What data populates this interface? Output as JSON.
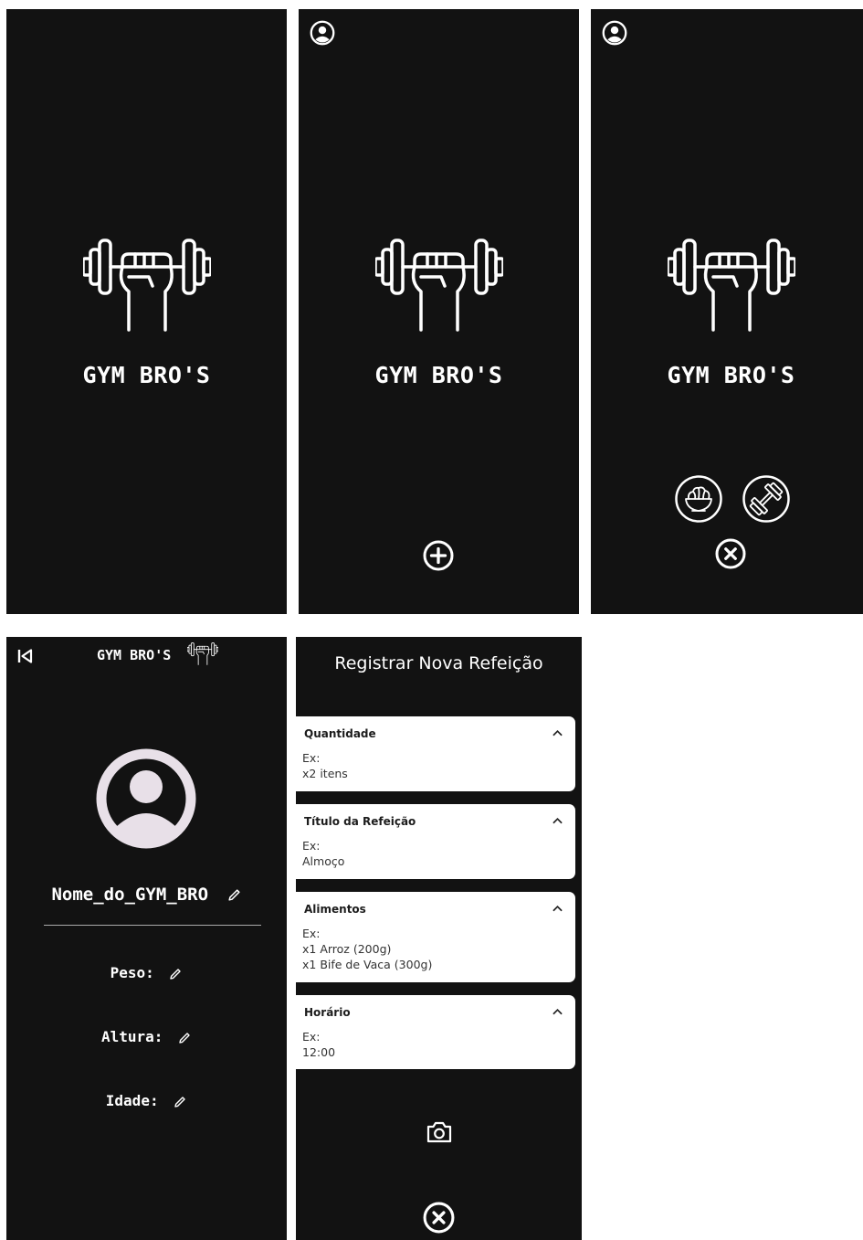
{
  "brand": "GYM BRO'S",
  "profile": {
    "title": "GYM BRO'S",
    "username": "Nome_do_GYM_BRO",
    "fields": [
      "Peso:",
      "Altura:",
      "Idade:"
    ]
  },
  "meal": {
    "title": "Registrar Nova Refeição",
    "cards": [
      {
        "label": "Quantidade",
        "lines": [
          "Ex:",
          "x2 itens"
        ]
      },
      {
        "label": "Título da Refeição",
        "lines": [
          "Ex:",
          "Almoço"
        ]
      },
      {
        "label": "Alimentos",
        "lines": [
          "Ex:",
          "x1 Arroz (200g)",
          "x1 Bife de Vaca (300g)"
        ]
      },
      {
        "label": "Horário",
        "lines": [
          "Ex:",
          "12:00"
        ]
      }
    ]
  },
  "icons": {
    "logo": "dumbbell-hand-icon",
    "profile": "user-circle-icon",
    "add": "plus-circle-icon",
    "close": "x-circle-icon",
    "food": "salad-bowl-icon",
    "workout": "dumbbell-icon",
    "back": "skip-back-icon",
    "edit": "pencil-icon",
    "camera": "camera-icon",
    "expand": "chevron-up-icon"
  },
  "colors": {
    "screen_bg": "#121212",
    "foreground": "#ffffff",
    "avatar": "#e8e0e8"
  }
}
